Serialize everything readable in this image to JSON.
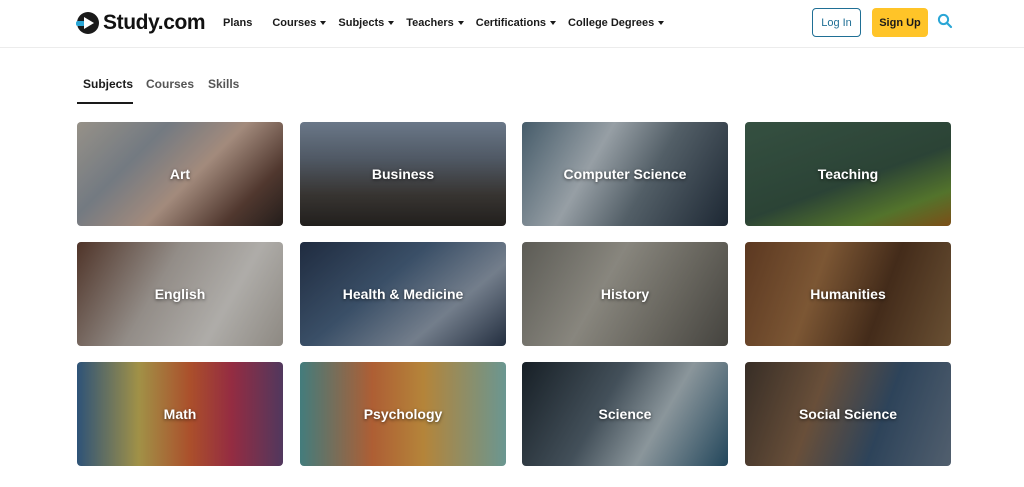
{
  "header": {
    "logo_text": "Study.com",
    "nav": [
      {
        "label": "Plans",
        "has_caret": false
      },
      {
        "label": "Courses",
        "has_caret": true
      },
      {
        "label": "Subjects",
        "has_caret": true
      },
      {
        "label": "Teachers",
        "has_caret": true
      },
      {
        "label": "Certifications",
        "has_caret": true
      },
      {
        "label": "College Degrees",
        "has_caret": true
      }
    ],
    "login_label": "Log In",
    "signup_label": "Sign Up",
    "search_icon": "search-icon"
  },
  "tabs": [
    {
      "label": "Subjects",
      "active": true
    },
    {
      "label": "Courses",
      "active": false
    },
    {
      "label": "Skills",
      "active": false
    }
  ],
  "subjects": [
    {
      "label": "Art"
    },
    {
      "label": "Business"
    },
    {
      "label": "Computer Science"
    },
    {
      "label": "Teaching"
    },
    {
      "label": "English"
    },
    {
      "label": "Health & Medicine"
    },
    {
      "label": "History"
    },
    {
      "label": "Humanities"
    },
    {
      "label": "Math"
    },
    {
      "label": "Psychology"
    },
    {
      "label": "Science"
    },
    {
      "label": "Social Science"
    }
  ],
  "colors": {
    "brand_accent": "#2aa6d6",
    "login_border": "#1f6f95",
    "signup_bg": "#ffc428"
  }
}
